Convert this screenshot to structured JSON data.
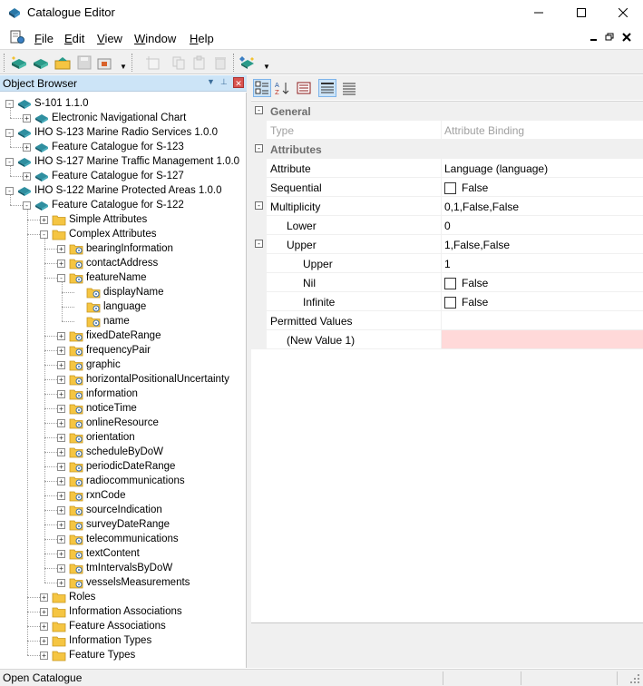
{
  "window": {
    "title": "Catalogue Editor"
  },
  "menu": {
    "items": [
      {
        "label": "File",
        "accel": "F",
        "rest": "ile"
      },
      {
        "label": "Edit",
        "accel": "E",
        "rest": "dit"
      },
      {
        "label": "View",
        "accel": "V",
        "rest": "iew"
      },
      {
        "label": "Window",
        "accel": "W",
        "rest": "indow"
      },
      {
        "label": "Help",
        "accel": "H",
        "rest": "elp"
      }
    ]
  },
  "object_browser": {
    "title": "Object Browser"
  },
  "tree": [
    {
      "label": "S-101 1.1.0",
      "depth": 0,
      "icon": "book-icon",
      "expander": "-"
    },
    {
      "label": "Electronic Navigational Chart",
      "depth": 1,
      "icon": "book-icon",
      "expander": "+"
    },
    {
      "label": "IHO S-123 Marine Radio Services 1.0.0",
      "depth": 0,
      "icon": "book-icon",
      "expander": "-"
    },
    {
      "label": "Feature Catalogue for S-123",
      "depth": 1,
      "icon": "book-icon",
      "expander": "+"
    },
    {
      "label": "IHO S-127 Marine Traffic Management 1.0.0",
      "depth": 0,
      "icon": "book-icon",
      "expander": "-"
    },
    {
      "label": "Feature Catalogue for S-127",
      "depth": 1,
      "icon": "book-icon",
      "expander": "+"
    },
    {
      "label": "IHO S-122 Marine Protected Areas 1.0.0",
      "depth": 0,
      "icon": "book-icon",
      "expander": "-"
    },
    {
      "label": "Feature Catalogue for S-122",
      "depth": 1,
      "icon": "book-icon",
      "expander": "-"
    },
    {
      "label": "Simple Attributes",
      "depth": 2,
      "icon": "folder-icon",
      "expander": "+"
    },
    {
      "label": "Complex Attributes",
      "depth": 2,
      "icon": "folder-icon",
      "expander": "-"
    },
    {
      "label": "bearingInformation",
      "depth": 3,
      "icon": "attribute-folder-icon",
      "expander": "+"
    },
    {
      "label": "contactAddress",
      "depth": 3,
      "icon": "attribute-folder-icon",
      "expander": "+"
    },
    {
      "label": "featureName",
      "depth": 3,
      "icon": "attribute-folder-icon",
      "expander": "-"
    },
    {
      "label": "displayName",
      "depth": 4,
      "icon": "attribute-folder-icon",
      "expander": ""
    },
    {
      "label": "language",
      "depth": 4,
      "icon": "attribute-folder-icon",
      "expander": ""
    },
    {
      "label": "name",
      "depth": 4,
      "icon": "attribute-folder-icon",
      "expander": ""
    },
    {
      "label": "fixedDateRange",
      "depth": 3,
      "icon": "attribute-folder-icon",
      "expander": "+"
    },
    {
      "label": "frequencyPair",
      "depth": 3,
      "icon": "attribute-folder-icon",
      "expander": "+"
    },
    {
      "label": "graphic",
      "depth": 3,
      "icon": "attribute-folder-icon",
      "expander": "+"
    },
    {
      "label": "horizontalPositionalUncertainty",
      "depth": 3,
      "icon": "attribute-folder-icon",
      "expander": "+"
    },
    {
      "label": "information",
      "depth": 3,
      "icon": "attribute-folder-icon",
      "expander": "+"
    },
    {
      "label": "noticeTime",
      "depth": 3,
      "icon": "attribute-folder-icon",
      "expander": "+"
    },
    {
      "label": "onlineResource",
      "depth": 3,
      "icon": "attribute-folder-icon",
      "expander": "+"
    },
    {
      "label": "orientation",
      "depth": 3,
      "icon": "attribute-folder-icon",
      "expander": "+"
    },
    {
      "label": "scheduleByDoW",
      "depth": 3,
      "icon": "attribute-folder-icon",
      "expander": "+"
    },
    {
      "label": "periodicDateRange",
      "depth": 3,
      "icon": "attribute-folder-icon",
      "expander": "+"
    },
    {
      "label": "radiocommunications",
      "depth": 3,
      "icon": "attribute-folder-icon",
      "expander": "+"
    },
    {
      "label": "rxnCode",
      "depth": 3,
      "icon": "attribute-folder-icon",
      "expander": "+"
    },
    {
      "label": "sourceIndication",
      "depth": 3,
      "icon": "attribute-folder-icon",
      "expander": "+"
    },
    {
      "label": "surveyDateRange",
      "depth": 3,
      "icon": "attribute-folder-icon",
      "expander": "+"
    },
    {
      "label": "telecommunications",
      "depth": 3,
      "icon": "attribute-folder-icon",
      "expander": "+"
    },
    {
      "label": "textContent",
      "depth": 3,
      "icon": "attribute-folder-icon",
      "expander": "+"
    },
    {
      "label": "tmIntervalsByDoW",
      "depth": 3,
      "icon": "attribute-folder-icon",
      "expander": "+"
    },
    {
      "label": "vesselsMeasurements",
      "depth": 3,
      "icon": "attribute-folder-icon",
      "expander": "+"
    },
    {
      "label": "Roles",
      "depth": 2,
      "icon": "folder-icon",
      "expander": "+"
    },
    {
      "label": "Information Associations",
      "depth": 2,
      "icon": "folder-icon",
      "expander": "+"
    },
    {
      "label": "Feature Associations",
      "depth": 2,
      "icon": "folder-icon",
      "expander": "+"
    },
    {
      "label": "Information Types",
      "depth": 2,
      "icon": "folder-icon",
      "expander": "+"
    },
    {
      "label": "Feature Types",
      "depth": 2,
      "icon": "folder-icon",
      "expander": "+"
    }
  ],
  "properties": [
    {
      "kind": "category",
      "name": "General",
      "expander": "-"
    },
    {
      "kind": "prop",
      "name": "Type",
      "value": "Attribute Binding",
      "indent": 0,
      "disabled": true
    },
    {
      "kind": "category",
      "name": "Attributes",
      "expander": "-"
    },
    {
      "kind": "prop",
      "name": "Attribute",
      "value": "Language (language)",
      "indent": 0
    },
    {
      "kind": "prop",
      "name": "Sequential",
      "value": "False",
      "indent": 0,
      "checkbox": true
    },
    {
      "kind": "prop",
      "name": "Multiplicity",
      "value": "0,1,False,False",
      "indent": 0,
      "expander": "-"
    },
    {
      "kind": "prop",
      "name": "Lower",
      "value": "0",
      "indent": 1
    },
    {
      "kind": "prop",
      "name": "Upper",
      "value": "1,False,False",
      "indent": 1,
      "expander": "-"
    },
    {
      "kind": "prop",
      "name": "Upper",
      "value": "1",
      "indent": 2
    },
    {
      "kind": "prop",
      "name": "Nil",
      "value": "False",
      "indent": 2,
      "checkbox": true
    },
    {
      "kind": "prop",
      "name": "Infinite",
      "value": "False",
      "indent": 2,
      "checkbox": true
    },
    {
      "kind": "prop",
      "name": "Permitted Values",
      "value": "",
      "indent": 0
    },
    {
      "kind": "prop",
      "name": "(New Value 1)",
      "value": "",
      "indent": 1,
      "highlight": true
    }
  ],
  "status": {
    "text": "Open Catalogue"
  },
  "colors": {
    "selection": "#cce4f7",
    "book": "#1e6f8a",
    "folder": "#f5c542",
    "invalid": "#ffd9d9"
  }
}
